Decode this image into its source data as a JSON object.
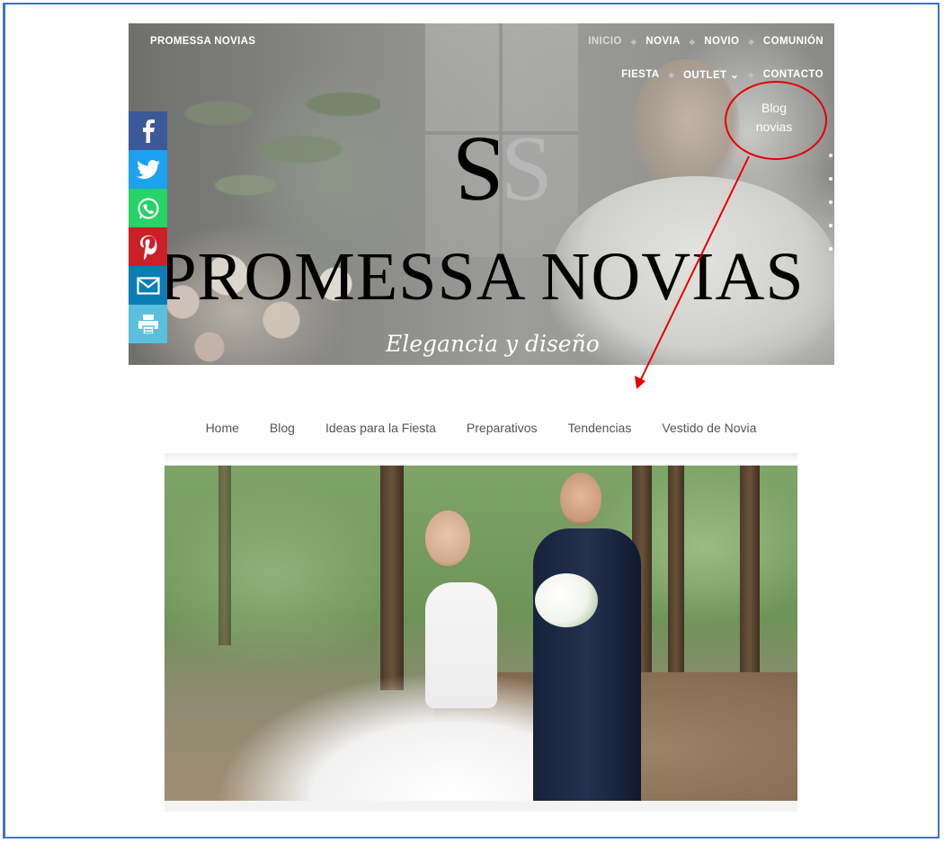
{
  "header": {
    "site_name": "PROMESSA NOVIAS",
    "nav_row1": [
      "INICIO",
      "NOVIA",
      "NOVIO",
      "COMUNIÓN"
    ],
    "nav_row2": [
      "FIESTA",
      "OUTLET",
      "CONTACTO"
    ],
    "outlet_chevron": "⌄"
  },
  "hero": {
    "logo": "SS",
    "title": "PROMESSA NOVIAS",
    "tagline": "Elegancia y diseño"
  },
  "social": {
    "icons": [
      "facebook-icon",
      "twitter-icon",
      "whatsapp-icon",
      "pinterest-icon",
      "email-icon",
      "print-icon"
    ],
    "colors": [
      "#3b5998",
      "#1da1f2",
      "#25d366",
      "#cb2027",
      "#0b7db5",
      "#5bc0de"
    ]
  },
  "annotation": {
    "text_line1": "Blog",
    "text_line2": "novias",
    "color": "#e60000"
  },
  "blog_nav": {
    "items": [
      "Home",
      "Blog",
      "Ideas para la Fiesta",
      "Preparativos",
      "Tendencias",
      "Vestido de Novia"
    ]
  },
  "photo": {
    "subject": "bride-and-groom-photo"
  },
  "colors": {
    "frame_border": "#4472c4"
  }
}
